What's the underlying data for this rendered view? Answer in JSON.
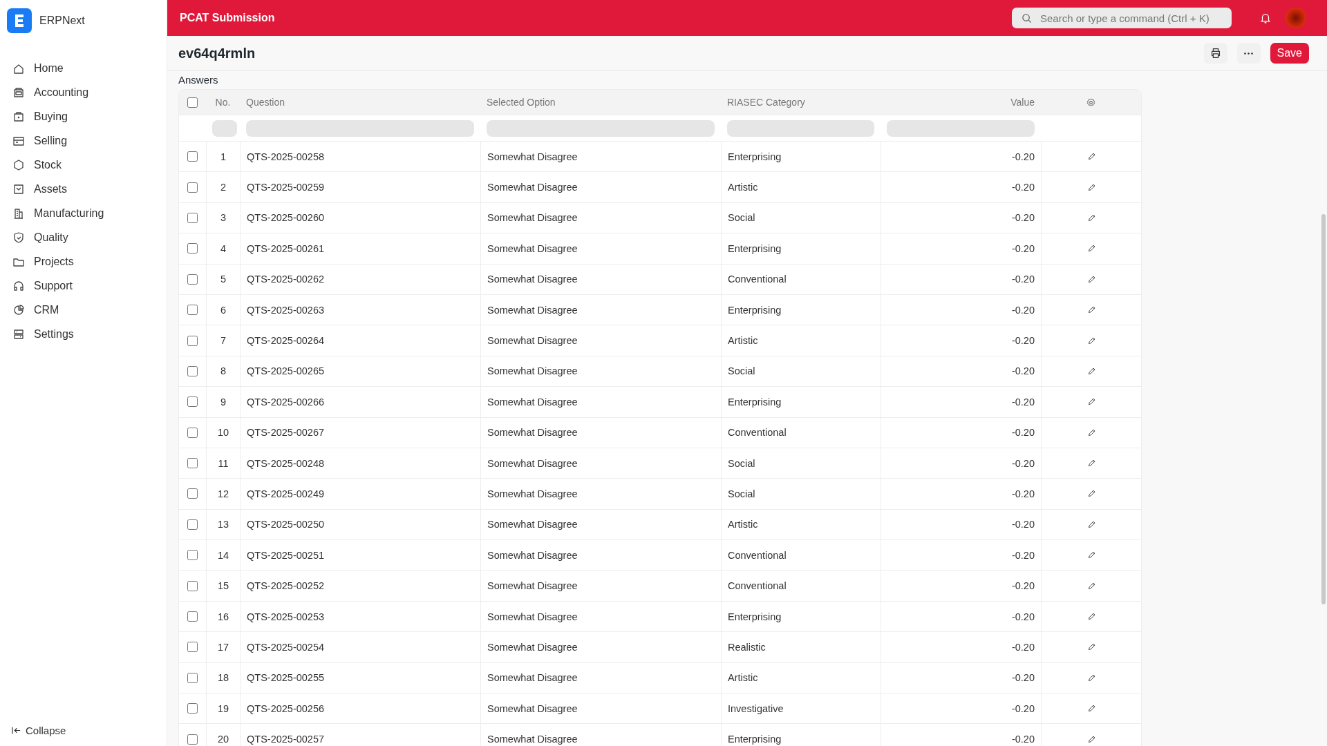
{
  "app": {
    "name": "ERPNext"
  },
  "sidebar": {
    "items": [
      {
        "label": "Home",
        "selected": false
      },
      {
        "label": "Accounting",
        "selected": false
      },
      {
        "label": "Buying",
        "selected": false
      },
      {
        "label": "Selling",
        "selected": false
      },
      {
        "label": "Stock",
        "selected": false
      },
      {
        "label": "Assets",
        "selected": false
      },
      {
        "label": "Manufacturing",
        "selected": false
      },
      {
        "label": "Quality",
        "selected": false
      },
      {
        "label": "Projects",
        "selected": false
      },
      {
        "label": "Support",
        "selected": false
      },
      {
        "label": "CRM",
        "selected": false
      },
      {
        "label": "Settings",
        "selected": false
      }
    ],
    "collapse": "Collapse"
  },
  "navbar": {
    "title": "PCAT Submission",
    "search": {
      "placeholder": "Search or type a command (Ctrl + K)"
    }
  },
  "page": {
    "title": "ev64q4rmln",
    "save": "Save"
  },
  "table": {
    "label": "Answers",
    "select_all": {
      "checked": false
    },
    "columns": [
      "No.",
      "Question",
      "Selected Option",
      "RIASEC Category",
      "Value"
    ],
    "rows": [
      {
        "no": "1",
        "question": "QTS-2025-00258",
        "option": "Somewhat Disagree",
        "category": "Enterprising",
        "value": "-0.20",
        "checked": false
      },
      {
        "no": "2",
        "question": "QTS-2025-00259",
        "option": "Somewhat Disagree",
        "category": "Artistic",
        "value": "-0.20",
        "checked": false
      },
      {
        "no": "3",
        "question": "QTS-2025-00260",
        "option": "Somewhat Disagree",
        "category": "Social",
        "value": "-0.20",
        "checked": false
      },
      {
        "no": "4",
        "question": "QTS-2025-00261",
        "option": "Somewhat Disagree",
        "category": "Enterprising",
        "value": "-0.20",
        "checked": false
      },
      {
        "no": "5",
        "question": "QTS-2025-00262",
        "option": "Somewhat Disagree",
        "category": "Conventional",
        "value": "-0.20",
        "checked": false
      },
      {
        "no": "6",
        "question": "QTS-2025-00263",
        "option": "Somewhat Disagree",
        "category": "Enterprising",
        "value": "-0.20",
        "checked": false
      },
      {
        "no": "7",
        "question": "QTS-2025-00264",
        "option": "Somewhat Disagree",
        "category": "Artistic",
        "value": "-0.20",
        "checked": false
      },
      {
        "no": "8",
        "question": "QTS-2025-00265",
        "option": "Somewhat Disagree",
        "category": "Social",
        "value": "-0.20",
        "checked": false
      },
      {
        "no": "9",
        "question": "QTS-2025-00266",
        "option": "Somewhat Disagree",
        "category": "Enterprising",
        "value": "-0.20",
        "checked": false
      },
      {
        "no": "10",
        "question": "QTS-2025-00267",
        "option": "Somewhat Disagree",
        "category": "Conventional",
        "value": "-0.20",
        "checked": false
      },
      {
        "no": "11",
        "question": "QTS-2025-00248",
        "option": "Somewhat Disagree",
        "category": "Social",
        "value": "-0.20",
        "checked": false
      },
      {
        "no": "12",
        "question": "QTS-2025-00249",
        "option": "Somewhat Disagree",
        "category": "Social",
        "value": "-0.20",
        "checked": false
      },
      {
        "no": "13",
        "question": "QTS-2025-00250",
        "option": "Somewhat Disagree",
        "category": "Artistic",
        "value": "-0.20",
        "checked": false
      },
      {
        "no": "14",
        "question": "QTS-2025-00251",
        "option": "Somewhat Disagree",
        "category": "Conventional",
        "value": "-0.20",
        "checked": false
      },
      {
        "no": "15",
        "question": "QTS-2025-00252",
        "option": "Somewhat Disagree",
        "category": "Conventional",
        "value": "-0.20",
        "checked": false
      },
      {
        "no": "16",
        "question": "QTS-2025-00253",
        "option": "Somewhat Disagree",
        "category": "Enterprising",
        "value": "-0.20",
        "checked": false
      },
      {
        "no": "17",
        "question": "QTS-2025-00254",
        "option": "Somewhat Disagree",
        "category": "Realistic",
        "value": "-0.20",
        "checked": false
      },
      {
        "no": "18",
        "question": "QTS-2025-00255",
        "option": "Somewhat Disagree",
        "category": "Artistic",
        "value": "-0.20",
        "checked": false
      },
      {
        "no": "19",
        "question": "QTS-2025-00256",
        "option": "Somewhat Disagree",
        "category": "Investigative",
        "value": "-0.20",
        "checked": false
      },
      {
        "no": "20",
        "question": "QTS-2025-00257",
        "option": "Somewhat Disagree",
        "category": "Enterprising",
        "value": "-0.20",
        "checked": false
      }
    ]
  }
}
